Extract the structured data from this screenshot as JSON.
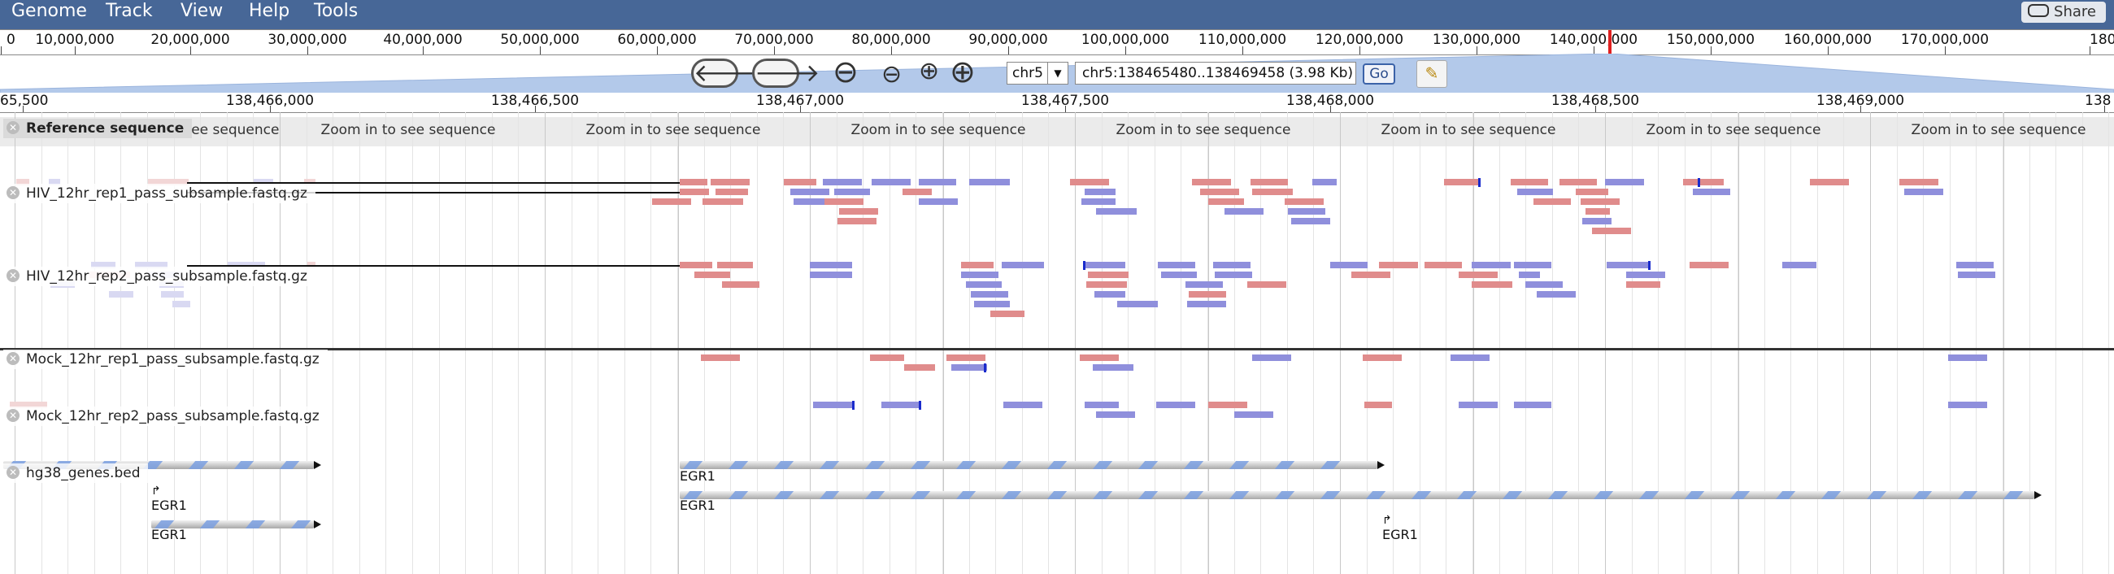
{
  "menu": {
    "items": [
      "Genome",
      "Track",
      "View",
      "Help",
      "Tools"
    ],
    "share_label": "Share"
  },
  "overview": {
    "ticks": [
      "0",
      "10,000,000",
      "20,000,000",
      "30,000,000",
      "40,000,000",
      "50,000,000",
      "60,000,000",
      "70,000,000",
      "80,000,000",
      "90,000,000",
      "100,000,000",
      "110,000,000",
      "120,000,000",
      "130,000,000",
      "140,000,000",
      "150,000,000",
      "160,000,000",
      "170,000,000",
      "180,000,0"
    ]
  },
  "nav": {
    "back_glyph": "🡐",
    "forward_glyph": "🡒",
    "chromosome": "chr5",
    "location": "chr5:138465480..138469458 (3.98 Kb)",
    "go_label": "Go",
    "zoom_out_big": "⊖",
    "zoom_out_small": "⊖",
    "zoom_in_small": "⊕",
    "zoom_in_big": "⊕",
    "highlight_glyph": "✎"
  },
  "ruler": {
    "ticks": [
      "65,500",
      "138,466,000",
      "138,466,500",
      "138,467,000",
      "138,467,500",
      "138,468,000",
      "138,468,500",
      "138,469,000",
      "138"
    ]
  },
  "reference": {
    "label": "Reference sequence",
    "placeholder": "Zoom in to see sequence"
  },
  "tracks": {
    "hiv_rep1": "HIV_12hr_rep1_pass_subsample.fastq.gz",
    "hiv_rep2": "HIV_12hr_rep2_pass_subsample.fastq.gz",
    "mock_rep1": "Mock_12hr_rep1_pass_subsample.fastq.gz",
    "mock_rep2": "Mock_12hr_rep2_pass_subsample.fastq.gz",
    "genes": "hg38_genes.bed"
  },
  "genes": {
    "label": "EGR1"
  },
  "colors": {
    "menubar": "#476797",
    "forward_read": "#e08c8c",
    "reverse_read": "#8f8fdc",
    "insertion": "#1a2bcc"
  }
}
